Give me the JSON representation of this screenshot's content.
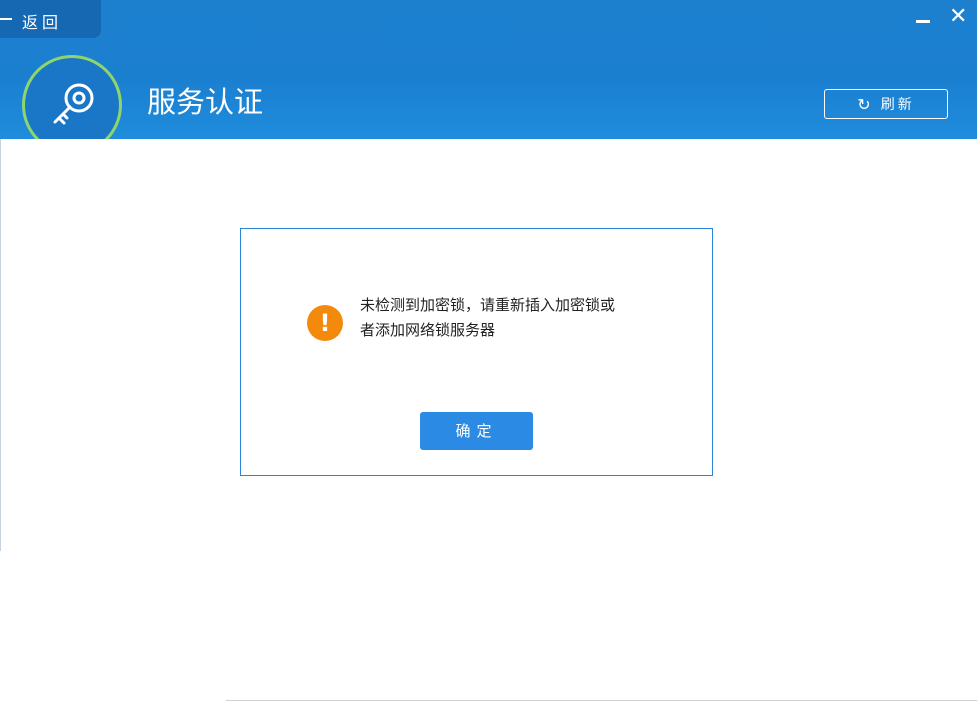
{
  "header": {
    "back_label": "返回",
    "title": "服务认证",
    "refresh_label": "刷新",
    "minimize_glyph": "–",
    "close_glyph": "✕"
  },
  "icons": {
    "back": "back-arrow-icon",
    "minimize": "minimize-icon",
    "close": "close-icon",
    "logo": "key-icon",
    "refresh": "refresh-icon",
    "warning": "warning-icon"
  },
  "dialog": {
    "message_line1": "未检测到加密锁，请重新插入加密锁或",
    "message_line2": "者添加网络锁服务器",
    "warning_glyph": "!",
    "ok_label": "确定"
  },
  "colors": {
    "header_blue": "#1d80cf",
    "logo_ring_green": "#8ed66c",
    "warning_orange": "#f38a0c",
    "button_blue": "#2b8ae3"
  }
}
